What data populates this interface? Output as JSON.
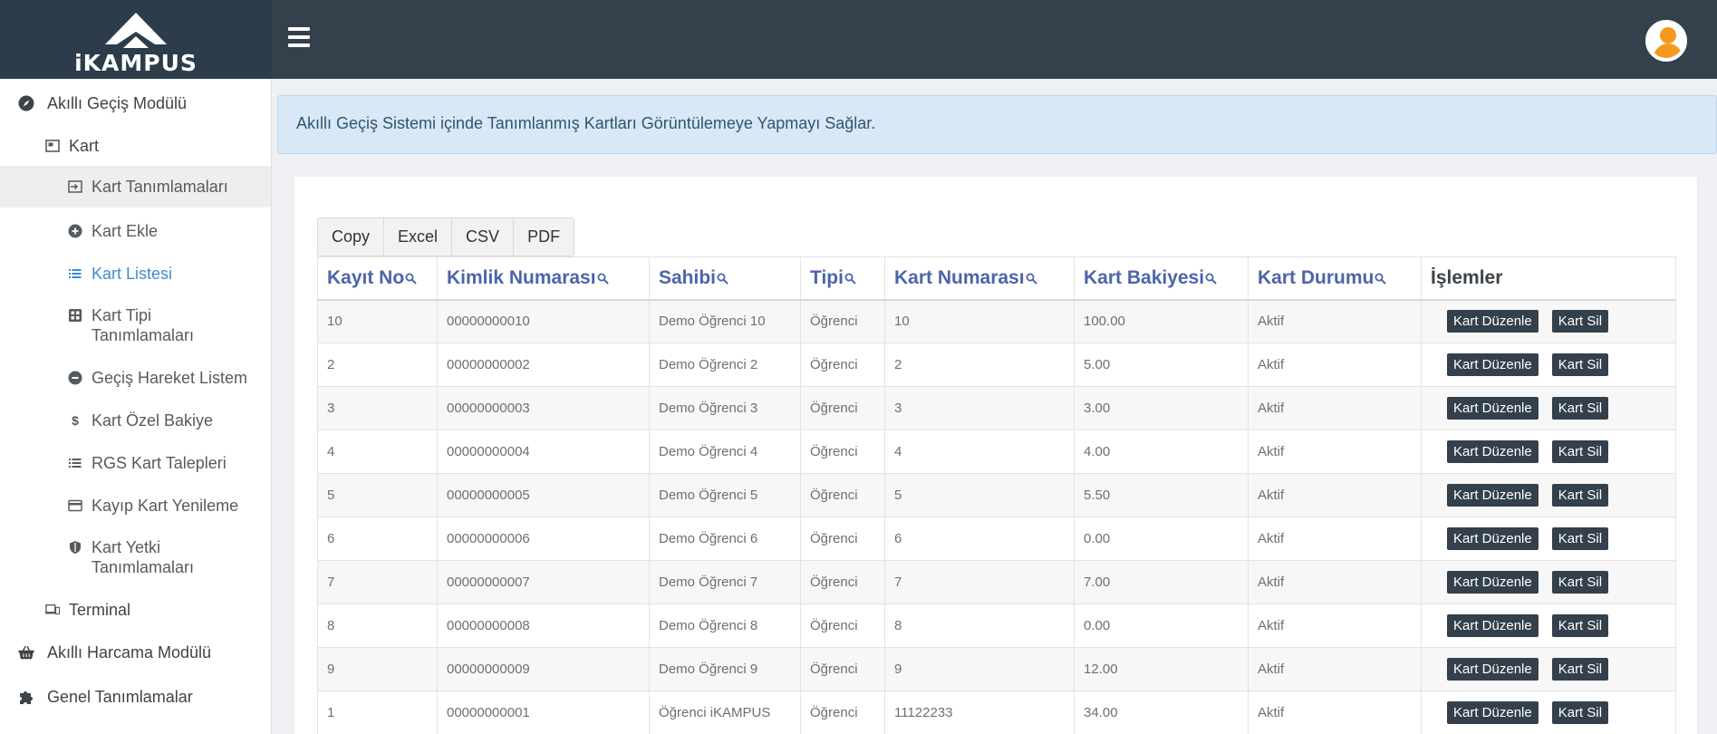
{
  "brand": {
    "name": "iKAMPUS"
  },
  "sidebar": {
    "items": [
      {
        "label": "Akıllı Geçiş Modülü",
        "icon": "compass-icon"
      },
      {
        "label": "Kart",
        "icon": "card-icon"
      },
      {
        "label": "Kart Tanımlamaları",
        "icon": "sign-in-icon"
      },
      {
        "label": "Kart Ekle",
        "icon": "plus-circle-icon"
      },
      {
        "label": "Kart Listesi",
        "icon": "list-icon"
      },
      {
        "label": "Kart Tipi Tanımlamaları",
        "icon": "grid-icon"
      },
      {
        "label": "Geçiş Hareket Listem",
        "icon": "minus-circle-icon"
      },
      {
        "label": "Kart Özel Bakiye",
        "icon": "dollar-icon"
      },
      {
        "label": "RGS Kart Talepleri",
        "icon": "list-icon"
      },
      {
        "label": "Kayıp Kart Yenileme",
        "icon": "credit-card-icon"
      },
      {
        "label": "Kart Yetki Tanımlamaları",
        "icon": "shield-icon"
      },
      {
        "label": "Terminal",
        "icon": "devices-icon"
      },
      {
        "label": "Akıllı Harcama Modülü",
        "icon": "basket-icon"
      },
      {
        "label": "Genel Tanımlamalar",
        "icon": "puzzle-icon"
      }
    ]
  },
  "alert": {
    "text": "Akıllı Geçiş Sistemi içinde Tanımlanmış Kartları Görüntülemeye Yapmayı Sağlar."
  },
  "export_buttons": [
    "Copy",
    "Excel",
    "CSV",
    "PDF"
  ],
  "table": {
    "headers": [
      "Kayıt No",
      "Kimlik Numarası",
      "Sahibi",
      "Tipi",
      "Kart Numarası",
      "Kart Bakiyesi",
      "Kart Durumu",
      "İşlemler"
    ],
    "edit_label": "Kart Düzenle",
    "delete_label": "Kart Sil",
    "rows": [
      [
        "10",
        "00000000010",
        "Demo Öğrenci 10",
        "Öğrenci",
        "10",
        "100.00",
        "Aktif"
      ],
      [
        "2",
        "00000000002",
        "Demo Öğrenci 2",
        "Öğrenci",
        "2",
        "5.00",
        "Aktif"
      ],
      [
        "3",
        "00000000003",
        "Demo Öğrenci 3",
        "Öğrenci",
        "3",
        "3.00",
        "Aktif"
      ],
      [
        "4",
        "00000000004",
        "Demo Öğrenci 4",
        "Öğrenci",
        "4",
        "4.00",
        "Aktif"
      ],
      [
        "5",
        "00000000005",
        "Demo Öğrenci 5",
        "Öğrenci",
        "5",
        "5.50",
        "Aktif"
      ],
      [
        "6",
        "00000000006",
        "Demo Öğrenci 6",
        "Öğrenci",
        "6",
        "0.00",
        "Aktif"
      ],
      [
        "7",
        "00000000007",
        "Demo Öğrenci 7",
        "Öğrenci",
        "7",
        "7.00",
        "Aktif"
      ],
      [
        "8",
        "00000000008",
        "Demo Öğrenci 8",
        "Öğrenci",
        "8",
        "0.00",
        "Aktif"
      ],
      [
        "9",
        "00000000009",
        "Demo Öğrenci 9",
        "Öğrenci",
        "9",
        "12.00",
        "Aktif"
      ],
      [
        "1",
        "00000000001",
        "Öğrenci iKAMPUS",
        "Öğrenci",
        "11122233",
        "34.00",
        "Aktif"
      ]
    ]
  },
  "colors": {
    "header_bg": "#34404c",
    "brand_bg": "#2c3c4a",
    "accent_link": "#3c8dd0",
    "avatar_orange": "#f39a1e",
    "action_button": "#34404c"
  }
}
